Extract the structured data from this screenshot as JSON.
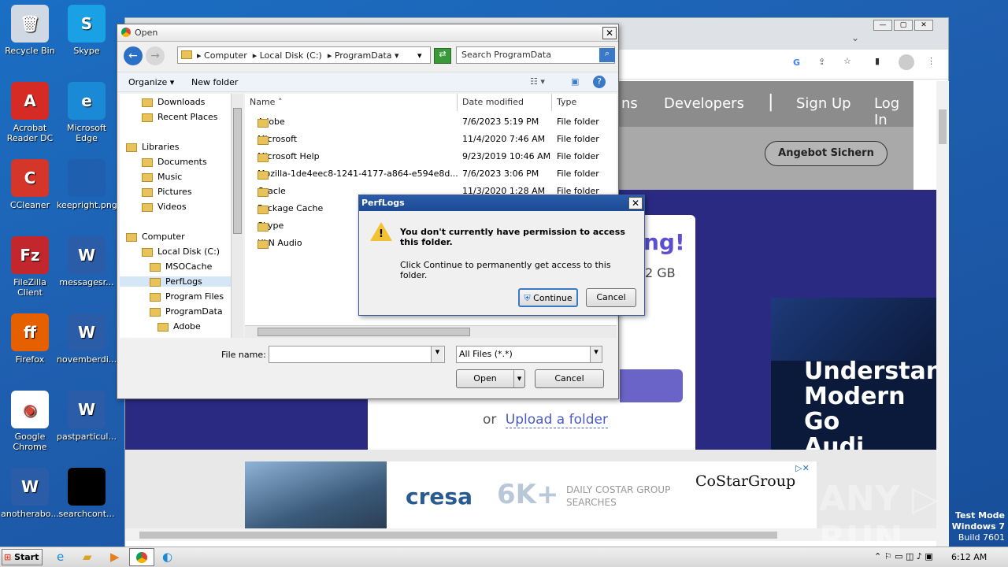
{
  "desktop": {
    "icons": [
      {
        "label": "Recycle Bin",
        "glyph": "🗑",
        "color": "#cfd8e3"
      },
      {
        "label": "Skype",
        "glyph": "S",
        "color": "#1aa1e5"
      },
      {
        "label": "Acrobat Reader DC",
        "glyph": "A",
        "color": "#d62b24"
      },
      {
        "label": "Microsoft Edge",
        "glyph": "e",
        "color": "#1b8ad6"
      },
      {
        "label": "CCleaner",
        "glyph": "C",
        "color": "#d4362a"
      },
      {
        "label": "keepright.png",
        "glyph": "",
        "color": "#1f5fb0"
      },
      {
        "label": "FileZilla Client",
        "glyph": "Fz",
        "color": "#c1272d"
      },
      {
        "label": "messagesr...",
        "glyph": "W",
        "color": "#2b5ca8"
      },
      {
        "label": "Firefox",
        "glyph": "ff",
        "color": "#e66000"
      },
      {
        "label": "novemberdi...",
        "glyph": "W",
        "color": "#2b5ca8"
      },
      {
        "label": "Google Chrome",
        "glyph": "◉",
        "color": "#ffffff"
      },
      {
        "label": "pastparticul...",
        "glyph": "W",
        "color": "#2b5ca8"
      },
      {
        "label": "anotherabo...",
        "glyph": "W",
        "color": "#2b5ca8"
      },
      {
        "label": "searchcont...",
        "glyph": "",
        "color": "#000000"
      }
    ],
    "watermark": {
      "brand": "ANY ▷ RUN",
      "line1": "Test Mode",
      "line2": "Windows 7",
      "line3": "Build 7601"
    }
  },
  "browser": {
    "nav": [
      "ns",
      "Developers",
      "Sign Up",
      "Log In"
    ],
    "cta": "Angebot Sichern",
    "headline_fragment": "ng!",
    "size_fragment": "2 GB",
    "upload_or": "or",
    "upload_link": "Upload a folder",
    "ad_right": {
      "line1": "Understan",
      "line2": "Modern Go",
      "line3": "Audi"
    },
    "banner": {
      "brand": "cresa",
      "big": "6K+",
      "small": "DAILY COSTAR GROUP SEARCHES",
      "partner": "CoStarGroup"
    }
  },
  "open_dialog": {
    "title": "Open",
    "breadcrumb": [
      "Computer",
      "Local Disk (C:)",
      "ProgramData"
    ],
    "search_placeholder": "Search ProgramData",
    "organize": "Organize",
    "new_folder": "New folder",
    "tree": [
      {
        "label": "Downloads",
        "indent": 1
      },
      {
        "label": "Recent Places",
        "indent": 1
      },
      {
        "label": "Libraries",
        "indent": 0
      },
      {
        "label": "Documents",
        "indent": 1
      },
      {
        "label": "Music",
        "indent": 1
      },
      {
        "label": "Pictures",
        "indent": 1
      },
      {
        "label": "Videos",
        "indent": 1
      },
      {
        "label": "Computer",
        "indent": 0
      },
      {
        "label": "Local Disk (C:)",
        "indent": 1
      },
      {
        "label": "MSOCache",
        "indent": 2
      },
      {
        "label": "PerfLogs",
        "indent": 2
      },
      {
        "label": "Program Files",
        "indent": 2
      },
      {
        "label": "ProgramData",
        "indent": 2
      },
      {
        "label": "Adobe",
        "indent": 3
      }
    ],
    "columns": [
      "Name",
      "Date modified",
      "Type"
    ],
    "files": [
      {
        "name": "Adobe",
        "date": "7/6/2023 5:19 PM",
        "type": "File folder"
      },
      {
        "name": "Microsoft",
        "date": "11/4/2020 7:46 AM",
        "type": "File folder"
      },
      {
        "name": "Microsoft Help",
        "date": "9/23/2019 10:46 AM",
        "type": "File folder"
      },
      {
        "name": "Mozilla-1de4eec8-1241-4177-a864-e594e8d...",
        "date": "7/6/2023 3:06 PM",
        "type": "File folder"
      },
      {
        "name": "Oracle",
        "date": "11/3/2020 1:28 AM",
        "type": "File folder"
      },
      {
        "name": "Package Cache",
        "date": "",
        "type": ""
      },
      {
        "name": "Skype",
        "date": "",
        "type": ""
      },
      {
        "name": "XLN Audio",
        "date": "",
        "type": ""
      }
    ],
    "filename_label": "File name:",
    "filename_value": "",
    "filter": "All Files (*.*)",
    "open_btn": "Open",
    "cancel_btn": "Cancel"
  },
  "perm_dialog": {
    "title": "PerfLogs",
    "message": "You don't currently have permission to access this folder.",
    "sub": "Click Continue to permanently get access to this folder.",
    "continue": "Continue",
    "cancel": "Cancel"
  },
  "taskbar": {
    "start": "Start",
    "time": "6:12 AM"
  }
}
